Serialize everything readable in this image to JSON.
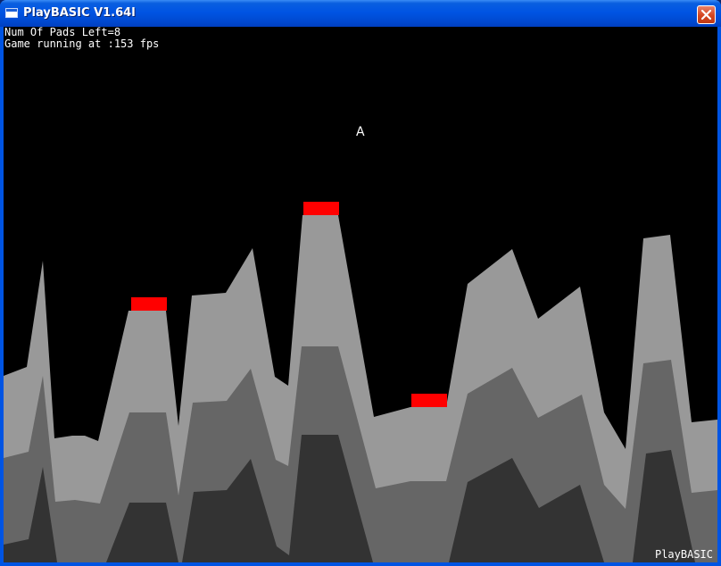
{
  "window": {
    "title": "PlayBASIC V1.64l",
    "close_icon": "close-icon",
    "app_icon": "window-icon"
  },
  "hud": {
    "pads_left": "Num Of Pads Left=8",
    "fps": "Game running at :153 fps"
  },
  "ship": {
    "glyph": "A"
  },
  "watermark": "PlayBASIC",
  "colors": {
    "background": "#000000",
    "terrain_light": "#999999",
    "terrain_mid": "#666666",
    "terrain_dark": "#333333",
    "landing_pad": "#ff0000",
    "titlebar": "#0054e3"
  },
  "landing_pads_visible": 3
}
